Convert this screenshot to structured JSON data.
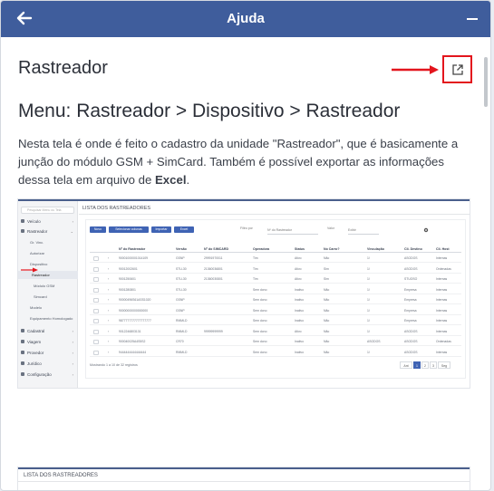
{
  "window": {
    "title": "Ajuda",
    "back_icon": "arrow-left-icon",
    "minimize_icon": "minus-icon",
    "header_color": "#3f5d9c"
  },
  "article": {
    "title": "Rastreador",
    "open_external_icon": "open-external-icon",
    "highlight_color": "#e3151d",
    "menu_path": "Menu: Rastreador > Dispositivo > Rastreador",
    "description_part1": "Nesta tela é onde é feito o cadastro da unidade \"Rastreador\", que é basicamente a junção do módulo GSM + SimCard. Também é possível exportar as informações dessa tela em arquivo de ",
    "description_bold": "Excel",
    "description_end": "."
  },
  "screenshot": {
    "page_heading": "LISTA DOS RASTREADORES",
    "sidebar": {
      "search_placeholder": "Pesquisar Menu ou Tela",
      "items": [
        "Veículo",
        "Rastreador",
        "Cadastral",
        "Viagem",
        "Provedor",
        "Jurídico",
        "Configuração"
      ],
      "sub_items": [
        "Gr. Vinc.",
        "Autorizar",
        "Dispositivo",
        "Rastreador",
        "Módulo GSM",
        "Simcard",
        "Modelo",
        "Equipamento Homologado"
      ]
    },
    "buttons": [
      "Novo",
      "Selecionar colunas",
      "Importar",
      "Excel"
    ],
    "filters": {
      "filter_label": "Filtro por",
      "filter_value": "Nº do Rastreador",
      "value_label": "Valor",
      "status_value": "Exibir"
    },
    "columns": [
      "Nº do Rastreador",
      "Versão",
      "Nº do SIMCARD",
      "Operadora",
      "Status",
      "No Carro?",
      "Vinculação",
      "Cli. Destino",
      "Cli. Host"
    ],
    "rows": [
      [
        "90001000001014109",
        "GSNP",
        "29991970011",
        "Tim",
        "Ativo",
        "Não",
        "1/",
        "ASODOS",
        "Internas"
      ],
      [
        "90012002601",
        "STU-30",
        "21360036801",
        "Tim",
        "Ativo",
        "Sim",
        "1/",
        "ASODOS",
        "Ordenadas"
      ],
      [
        "9001250601",
        "STU-30",
        "21360030801",
        "Tim",
        "Ativo",
        "Sim",
        "1/",
        "STUOSO",
        "Internas"
      ],
      [
        "9001280801",
        "STU-30",
        "",
        "Sem dono",
        "Inativo",
        "Não",
        "1/",
        "Empresa",
        "Internas"
      ],
      [
        "90000496S61ASS1020",
        "GSNP",
        "",
        "Sem dono",
        "Inativo",
        "Não",
        "1/",
        "Empresa",
        "Internas"
      ],
      [
        "90000000000000000",
        "GSNP",
        "",
        "Sem dono",
        "Inativo",
        "Não",
        "1/",
        "Empresa",
        "Internas"
      ],
      [
        "9877777777777777777",
        "RMMLD",
        "",
        "Sem dono",
        "Inativo",
        "Não",
        "1/",
        "Empresa",
        "Internas"
      ],
      [
        "9012246803131",
        "RMMLD",
        "99999999999",
        "Sem dono",
        "Ativo",
        "Não",
        "1/",
        "ASODOS",
        "Internas"
      ],
      [
        "900040025A4S5S2",
        "CR70",
        "",
        "Sem dono",
        "Inativo",
        "Não",
        "ASODOS",
        "ASODOS",
        "Ordenadas"
      ],
      [
        "9444444444444444",
        "RMMLD",
        "",
        "Sem dono",
        "Inativo",
        "Não",
        "1/",
        "ASODOS",
        "Internas"
      ]
    ],
    "footer": "Mostrando 1 a 10 de 32 registros",
    "pagination": [
      "Ant",
      "1",
      "2",
      "3",
      "Seg"
    ],
    "accent_color": "#3f63b4"
  },
  "screenshot2": {
    "page_heading": "LISTA DOS RASTREADORES"
  }
}
